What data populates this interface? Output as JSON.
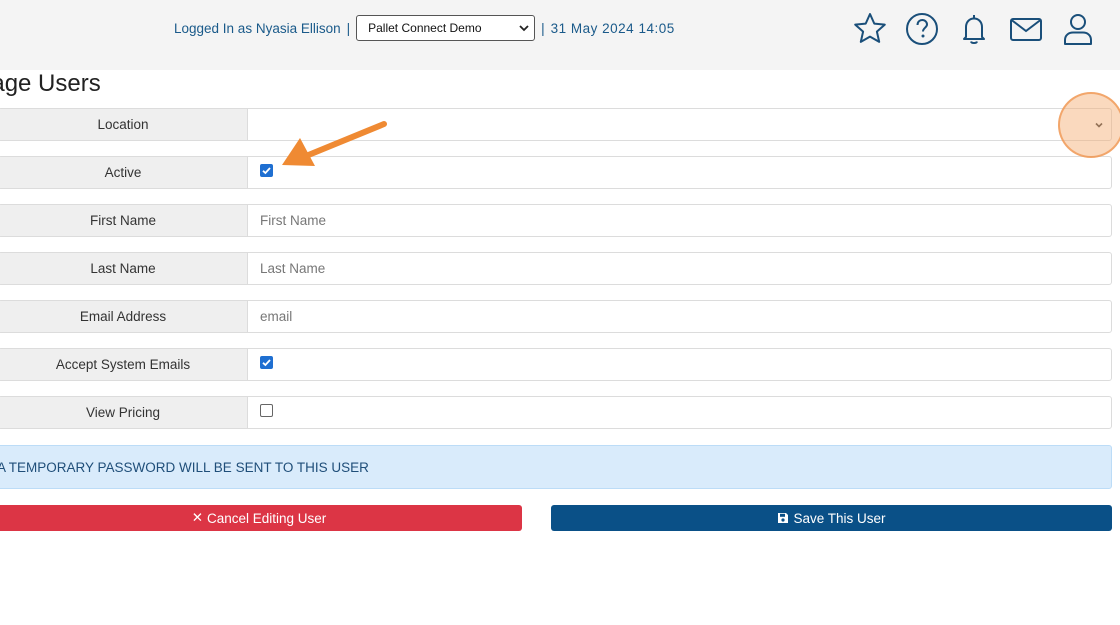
{
  "header": {
    "logged_in_text": "Logged In as Nyasia Ellison",
    "separator": "|",
    "company_selected": "Pallet Connect Demo",
    "datetime": "31 May 2024 14:05",
    "icons": [
      "star-icon",
      "help-icon",
      "bell-icon",
      "mail-icon",
      "user-icon"
    ]
  },
  "page": {
    "title": "nage Users"
  },
  "form": {
    "location_label": "Location",
    "location_value": "",
    "active_label": "Active",
    "active_checked": true,
    "first_name_label": "First Name",
    "first_name_placeholder": "First Name",
    "last_name_label": "Last Name",
    "last_name_placeholder": "Last Name",
    "email_label": "Email Address",
    "email_placeholder": "email",
    "accept_emails_label": "Accept System Emails",
    "accept_emails_checked": true,
    "view_pricing_label": "View Pricing",
    "view_pricing_checked": false
  },
  "notice": {
    "text": "A TEMPORARY PASSWORD WILL BE SENT TO THIS USER"
  },
  "buttons": {
    "cancel_icon": "✕",
    "cancel_label": "Cancel Editing User",
    "save_label": "Save This User"
  },
  "colors": {
    "accent_blue": "#0a5087",
    "cancel_red": "#dc3545",
    "link_blue": "#1a5a8a",
    "annotation_orange": "#ef8a33",
    "notice_bg": "#d9ebfb"
  }
}
